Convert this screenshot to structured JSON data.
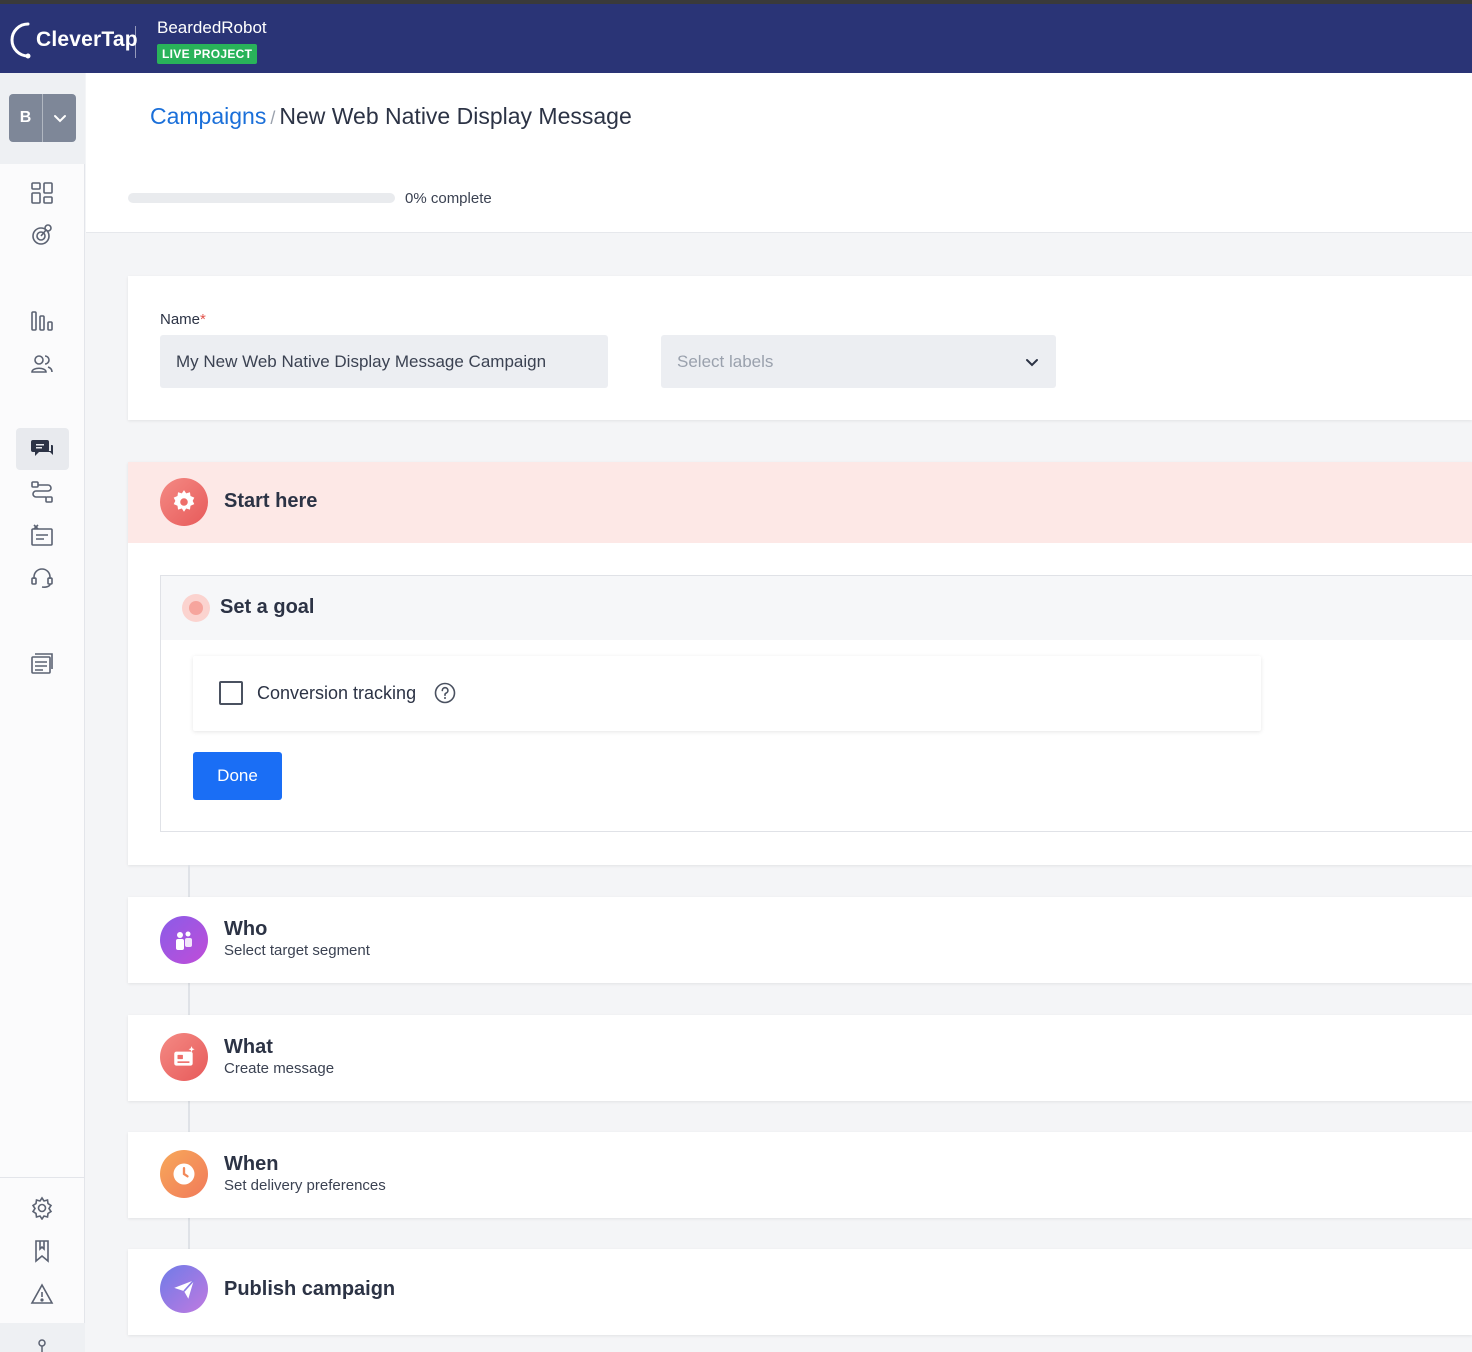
{
  "topbar": {
    "logo_text": "CleverTap",
    "project_name": "BeardedRobot",
    "project_badge": "LIVE PROJECT"
  },
  "sidebar": {
    "account_letter": "B",
    "items": [
      {
        "icon": "dashboard-icon"
      },
      {
        "icon": "analytics-target-icon"
      },
      {
        "icon": "bar-chart-icon"
      },
      {
        "icon": "users-icon"
      },
      {
        "icon": "messages-icon",
        "active": true
      },
      {
        "icon": "journeys-icon"
      },
      {
        "icon": "campaign-list-icon"
      },
      {
        "icon": "support-headset-icon"
      },
      {
        "icon": "catalog-icon"
      },
      {
        "icon": "settings-gear-icon"
      },
      {
        "icon": "bookmark-icon"
      },
      {
        "icon": "warning-icon"
      }
    ]
  },
  "breadcrumb": {
    "link": "Campaigns",
    "separator": "/",
    "current": "New Web Native Display Message"
  },
  "progress": {
    "percent": 0,
    "label": "0% complete"
  },
  "name_section": {
    "label": "Name",
    "required_mark": "*",
    "value": "My New Web Native Display Message Campaign",
    "labels_placeholder": "Select labels"
  },
  "start": {
    "title": "Start here",
    "goal": {
      "title": "Set a goal",
      "conversion_label": "Conversion tracking",
      "conversion_checked": false,
      "done_label": "Done"
    }
  },
  "steps": [
    {
      "key": "who",
      "title": "Who",
      "subtitle": "Select target segment",
      "color": "#a24fe0"
    },
    {
      "key": "what",
      "title": "What",
      "subtitle": "Create message",
      "color": "#ee6b6b"
    },
    {
      "key": "when",
      "title": "When",
      "subtitle": "Set delivery preferences",
      "color": "#f7935a"
    }
  ],
  "publish": {
    "title": "Publish campaign"
  },
  "colors": {
    "topbar": "#2a3476",
    "live_badge": "#29b35a",
    "link": "#1a6fd9",
    "primary_button": "#1a6ef5",
    "start_header_bg": "#fde8e6"
  }
}
